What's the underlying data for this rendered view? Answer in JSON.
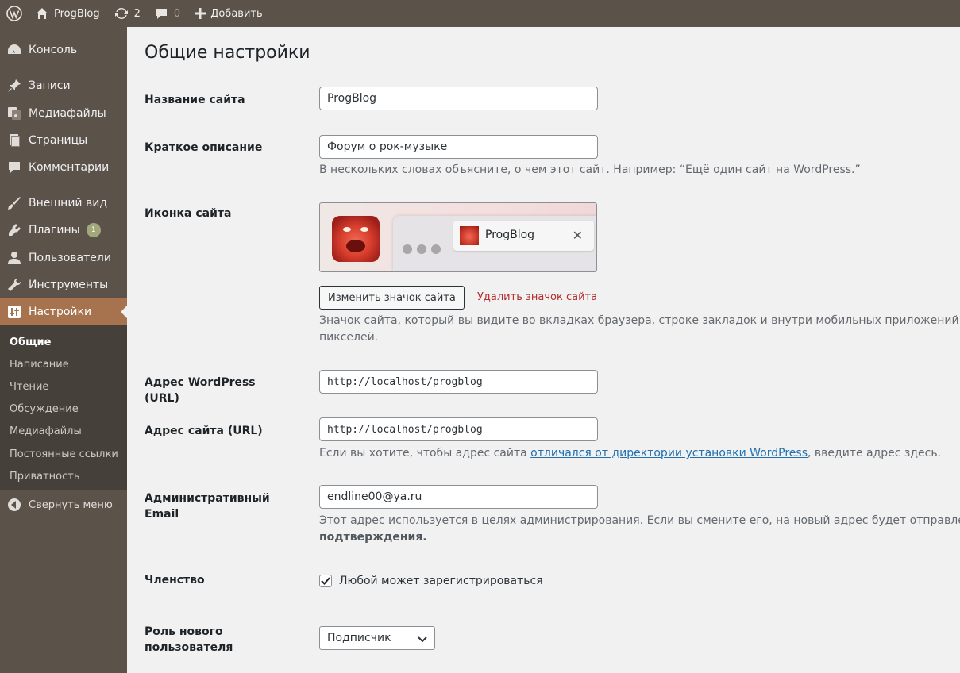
{
  "adminbar": {
    "site_name": "ProgBlog",
    "updates_count": "2",
    "comments_count": "0",
    "add_new_label": "Добавить"
  },
  "sidebar": {
    "items": [
      {
        "label": "Консоль",
        "icon": "dashboard-icon"
      },
      {
        "label": "Записи",
        "icon": "pin-icon"
      },
      {
        "label": "Медиафайлы",
        "icon": "media-icon"
      },
      {
        "label": "Страницы",
        "icon": "pages-icon"
      },
      {
        "label": "Комментарии",
        "icon": "comment-icon"
      },
      {
        "label": "Внешний вид",
        "icon": "brush-icon"
      },
      {
        "label": "Плагины",
        "icon": "plugin-icon",
        "badge": "1"
      },
      {
        "label": "Пользователи",
        "icon": "user-icon"
      },
      {
        "label": "Инструменты",
        "icon": "wrench-icon"
      },
      {
        "label": "Настройки",
        "icon": "settings-icon",
        "current": true
      }
    ],
    "submenu": [
      "Общие",
      "Написание",
      "Чтение",
      "Обсуждение",
      "Медиафайлы",
      "Постоянные ссылки",
      "Приватность"
    ],
    "collapse_label": "Свернуть меню"
  },
  "page": {
    "title": "Общие настройки",
    "site_title_label": "Название сайта",
    "site_title_value": "ProgBlog",
    "tagline_label": "Краткое описание",
    "tagline_value": "Форум о рок-музыке",
    "tagline_desc": "В нескольких словах объясните, о чем этот сайт. Например: “Ещё один сайт на WordPress.”",
    "site_icon_label": "Иконка сайта",
    "icon_preview_tab_title": "ProgBlog",
    "change_icon_button": "Изменить значок сайта",
    "remove_icon_link": "Удалить значок сайта",
    "site_icon_desc_line1": "Значок сайта, который вы видите во вкладках браузера, строке закладок и внутри мобильных приложений W",
    "site_icon_desc_line2": "пикселей.",
    "wp_url_label": "Адрес WordPress (URL)",
    "wp_url_value": "http://localhost/progblog",
    "site_url_label": "Адрес сайта (URL)",
    "site_url_value": "http://localhost/progblog",
    "site_url_desc_before": "Если вы хотите, чтобы адрес сайта ",
    "site_url_desc_link": "отличался от директории установки WordPress",
    "site_url_desc_after": ", введите адрес здесь.",
    "admin_email_label_line1": "Административный",
    "admin_email_label_line2": "Email",
    "admin_email_value": "endline00@ya.ru",
    "admin_email_desc_line1": "Этот адрес используется в целях администрирования. Если вы смените его, на новый адрес будет отправлено",
    "admin_email_desc_line2": "подтверждения.",
    "membership_label": "Членство",
    "membership_checkbox_label": "Любой может зарегистрироваться",
    "membership_checked": true,
    "new_user_role_label_line1": "Роль нового",
    "new_user_role_label_line2": "пользователя",
    "new_user_role_value": "Подписчик"
  },
  "colors": {
    "adminbar_bg": "#5b524a",
    "menu_current": "#a6734e",
    "submenu_bg": "#46403a",
    "link": "#2271b1",
    "delete_link": "#b32d2e"
  }
}
